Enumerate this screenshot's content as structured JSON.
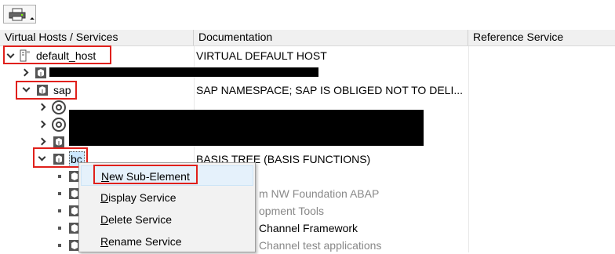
{
  "toolbar": {
    "print_icon": "printer-icon"
  },
  "columns": {
    "col1": "Virtual Hosts / Services",
    "col2": "Documentation",
    "col3": "Reference Service"
  },
  "tree": {
    "default_host": {
      "label": "default_host",
      "doc": "VIRTUAL DEFAULT HOST"
    },
    "sap": {
      "label": "sap",
      "doc": "SAP NAMESPACE; SAP IS OBLIGED NOT TO DELI..."
    },
    "bc": {
      "label": "bc",
      "doc": "BASIS TREE (BASIS FUNCTIONS)"
    },
    "row_partial_doc": "",
    "child_docs": [
      "m NW Foundation ABAP",
      "opment Tools",
      "Channel Framework",
      "Channel test applications"
    ]
  },
  "context_menu": {
    "items": [
      {
        "mnemonic": "N",
        "rest": "ew Sub-Element"
      },
      {
        "mnemonic": "D",
        "rest": "isplay Service"
      },
      {
        "mnemonic": "D",
        "rest": "elete Service"
      },
      {
        "mnemonic": "R",
        "rest": "ename Service"
      }
    ]
  },
  "colors": {
    "annotation_red": "#e0201b",
    "highlight": "#e5f1fb",
    "selection": "#cce8ff"
  }
}
